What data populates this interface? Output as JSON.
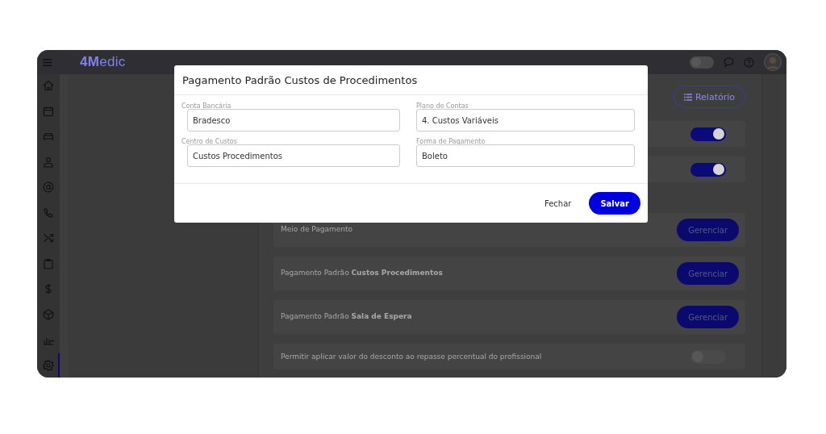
{
  "topbar": {
    "logo": "**4M**edic",
    "toggle": {
      "on": false
    }
  },
  "sidebar": {
    "items": [
      {
        "kind": "home",
        "selected": false
      },
      {
        "kind": "calendar",
        "selected": false
      },
      {
        "kind": "sofa",
        "selected": false
      },
      {
        "kind": "person",
        "selected": false
      },
      {
        "kind": "at",
        "selected": false
      },
      {
        "kind": "phone",
        "selected": false
      },
      {
        "kind": "shuffle",
        "selected": false
      },
      {
        "kind": "clipboard",
        "selected": false
      },
      {
        "kind": "dollar",
        "selected": false
      },
      {
        "kind": "box",
        "selected": false
      },
      {
        "kind": "chart",
        "selected": false
      },
      {
        "kind": "gear",
        "selected": true
      }
    ]
  },
  "report_button": "Relatório",
  "settings": [
    {
      "kind": "toggle",
      "on": true
    },
    {
      "kind": "toggle",
      "on": true
    },
    {
      "kind": "manage",
      "label": "Meio de Pagamento",
      "button": "Gerenciar"
    },
    {
      "kind": "manage",
      "label": "Pagamento Padrão **Custos Procedimentos**",
      "button": "Gerenciar"
    },
    {
      "kind": "manage",
      "label": "Pagamento Padrão **Sala de Espera**",
      "button": "Gerenciar"
    },
    {
      "kind": "toggle",
      "label": "Permitir aplicar valor do desconto ao repasse percentual do profissional",
      "on": false
    }
  ],
  "modal": {
    "title": "Pagamento Padrão Custos de Procedimentos",
    "fields": [
      {
        "label": "Conta Bancária",
        "value": "Bradesco"
      },
      {
        "label": "Plano de Contas",
        "value": "4. Custos Variáveis"
      },
      {
        "label": "Centro de Custos",
        "value": "Custos Procedimentos"
      },
      {
        "label": "Forma de Pagamento",
        "value": "Boleto"
      }
    ],
    "close_button": "Fechar",
    "save_button": "Salvar"
  }
}
